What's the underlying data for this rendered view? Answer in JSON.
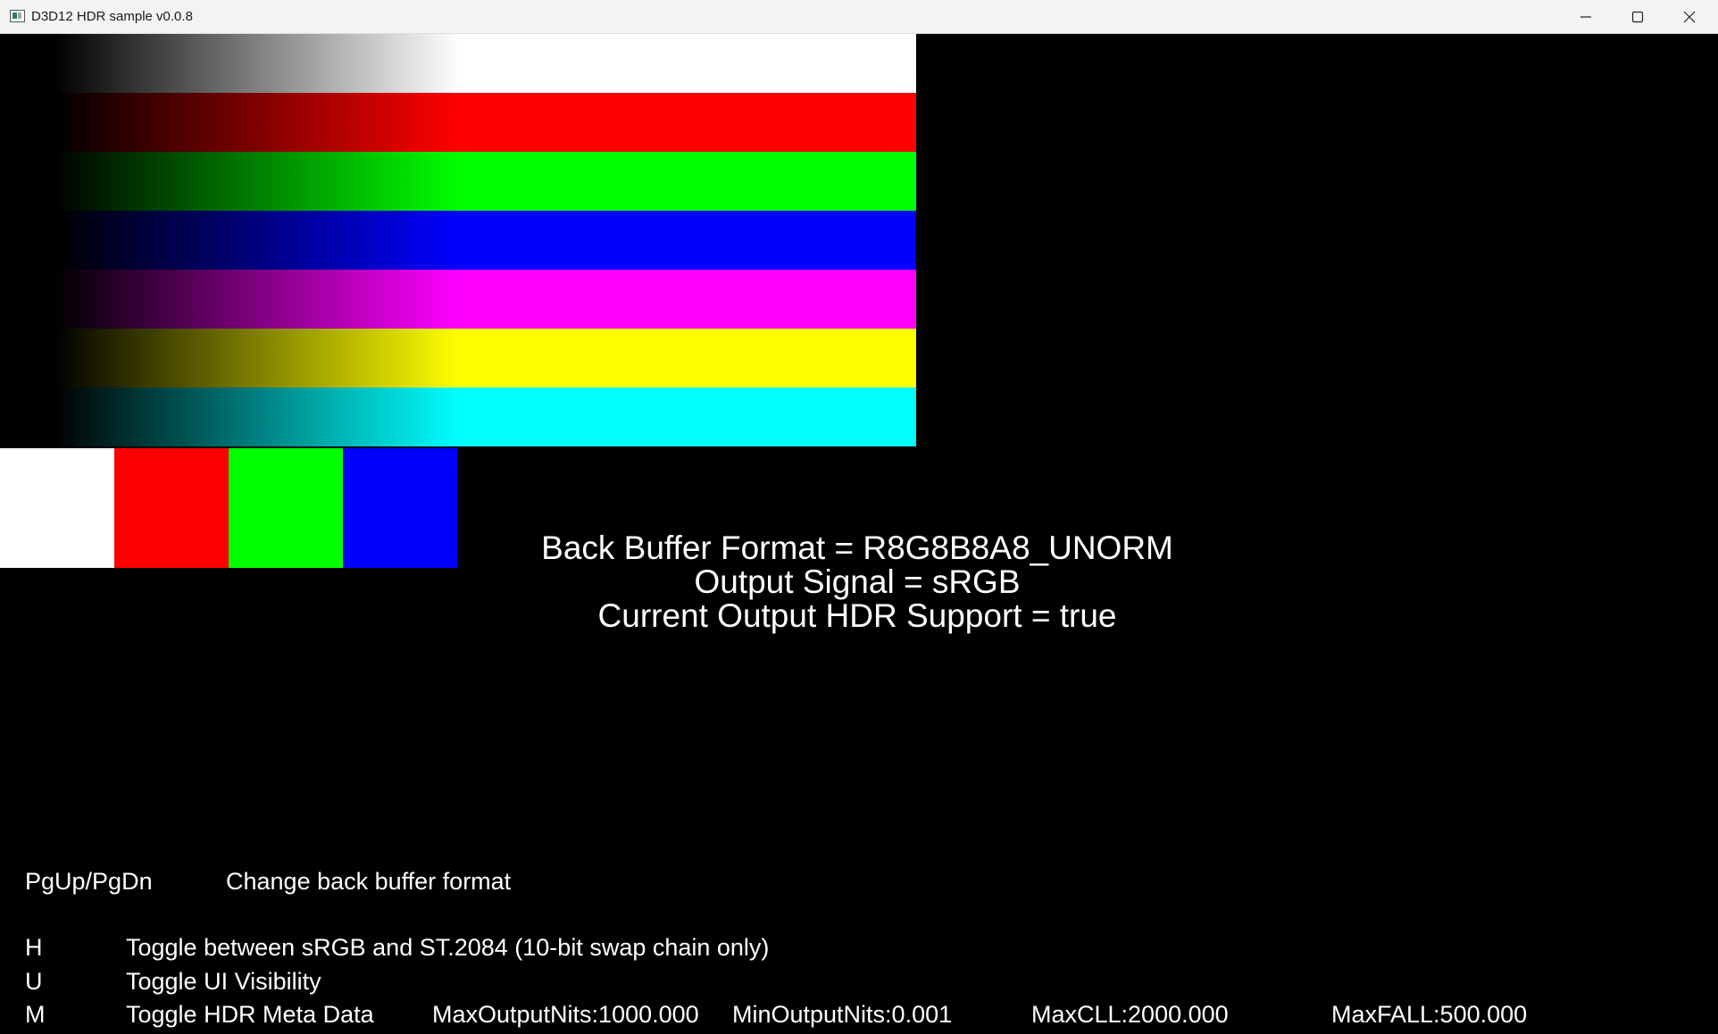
{
  "window": {
    "title": "D3D12 HDR sample v0.0.8",
    "icons": {
      "app": "app-window-icon",
      "minimize": "minimize-icon",
      "maximize": "maximize-icon",
      "close": "close-icon"
    }
  },
  "gradient_bars": [
    {
      "name": "white",
      "color": "#ffffff"
    },
    {
      "name": "red",
      "color": "#ff0000"
    },
    {
      "name": "green",
      "color": "#00ff00"
    },
    {
      "name": "blue",
      "color": "#0000ff"
    },
    {
      "name": "magenta",
      "color": "#ff00ff"
    },
    {
      "name": "yellow",
      "color": "#ffff00"
    },
    {
      "name": "cyan",
      "color": "#00ffff"
    }
  ],
  "swatches": [
    {
      "name": "white",
      "color": "#ffffff"
    },
    {
      "name": "red",
      "color": "#ff0000"
    },
    {
      "name": "green",
      "color": "#00ff00"
    },
    {
      "name": "blue",
      "color": "#0000ff"
    }
  ],
  "status": {
    "back_buffer_format": "Back Buffer Format = R8G8B8A8_UNORM",
    "output_signal": "Output Signal = sRGB",
    "hdr_support": "Current Output HDR Support = true"
  },
  "help": {
    "pgup_key": "PgUp/PgDn",
    "pgup_desc": "Change back buffer format",
    "h_key": "H",
    "h_desc": "Toggle between sRGB and ST.2084 (10-bit swap chain only)",
    "u_key": "U",
    "u_desc": "Toggle UI Visibility",
    "m_key": "M",
    "m_desc": "Toggle HDR Meta Data",
    "max_output_nits": "MaxOutputNits:1000.000",
    "min_output_nits": "MinOutputNits:0.001",
    "max_cll": "MaxCLL:2000.000",
    "max_fall": "MaxFALL:500.000"
  }
}
